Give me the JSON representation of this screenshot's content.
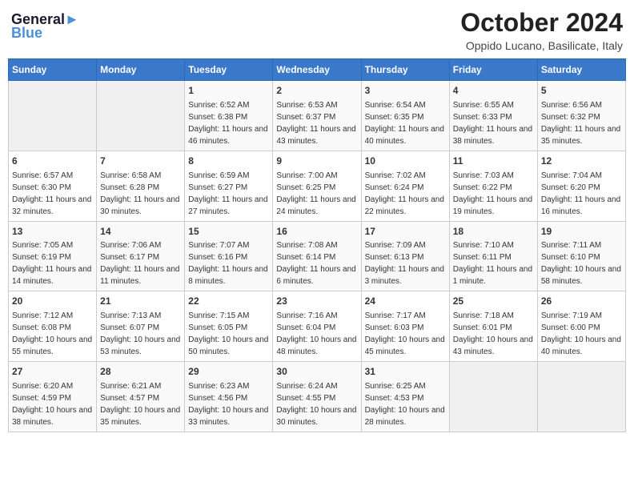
{
  "header": {
    "logo_line1": "General",
    "logo_line2": "Blue",
    "month": "October 2024",
    "location": "Oppido Lucano, Basilicate, Italy"
  },
  "days_of_week": [
    "Sunday",
    "Monday",
    "Tuesday",
    "Wednesday",
    "Thursday",
    "Friday",
    "Saturday"
  ],
  "weeks": [
    [
      {
        "day": "",
        "detail": ""
      },
      {
        "day": "",
        "detail": ""
      },
      {
        "day": "1",
        "detail": "Sunrise: 6:52 AM\nSunset: 6:38 PM\nDaylight: 11 hours and 46 minutes."
      },
      {
        "day": "2",
        "detail": "Sunrise: 6:53 AM\nSunset: 6:37 PM\nDaylight: 11 hours and 43 minutes."
      },
      {
        "day": "3",
        "detail": "Sunrise: 6:54 AM\nSunset: 6:35 PM\nDaylight: 11 hours and 40 minutes."
      },
      {
        "day": "4",
        "detail": "Sunrise: 6:55 AM\nSunset: 6:33 PM\nDaylight: 11 hours and 38 minutes."
      },
      {
        "day": "5",
        "detail": "Sunrise: 6:56 AM\nSunset: 6:32 PM\nDaylight: 11 hours and 35 minutes."
      }
    ],
    [
      {
        "day": "6",
        "detail": "Sunrise: 6:57 AM\nSunset: 6:30 PM\nDaylight: 11 hours and 32 minutes."
      },
      {
        "day": "7",
        "detail": "Sunrise: 6:58 AM\nSunset: 6:28 PM\nDaylight: 11 hours and 30 minutes."
      },
      {
        "day": "8",
        "detail": "Sunrise: 6:59 AM\nSunset: 6:27 PM\nDaylight: 11 hours and 27 minutes."
      },
      {
        "day": "9",
        "detail": "Sunrise: 7:00 AM\nSunset: 6:25 PM\nDaylight: 11 hours and 24 minutes."
      },
      {
        "day": "10",
        "detail": "Sunrise: 7:02 AM\nSunset: 6:24 PM\nDaylight: 11 hours and 22 minutes."
      },
      {
        "day": "11",
        "detail": "Sunrise: 7:03 AM\nSunset: 6:22 PM\nDaylight: 11 hours and 19 minutes."
      },
      {
        "day": "12",
        "detail": "Sunrise: 7:04 AM\nSunset: 6:20 PM\nDaylight: 11 hours and 16 minutes."
      }
    ],
    [
      {
        "day": "13",
        "detail": "Sunrise: 7:05 AM\nSunset: 6:19 PM\nDaylight: 11 hours and 14 minutes."
      },
      {
        "day": "14",
        "detail": "Sunrise: 7:06 AM\nSunset: 6:17 PM\nDaylight: 11 hours and 11 minutes."
      },
      {
        "day": "15",
        "detail": "Sunrise: 7:07 AM\nSunset: 6:16 PM\nDaylight: 11 hours and 8 minutes."
      },
      {
        "day": "16",
        "detail": "Sunrise: 7:08 AM\nSunset: 6:14 PM\nDaylight: 11 hours and 6 minutes."
      },
      {
        "day": "17",
        "detail": "Sunrise: 7:09 AM\nSunset: 6:13 PM\nDaylight: 11 hours and 3 minutes."
      },
      {
        "day": "18",
        "detail": "Sunrise: 7:10 AM\nSunset: 6:11 PM\nDaylight: 11 hours and 1 minute."
      },
      {
        "day": "19",
        "detail": "Sunrise: 7:11 AM\nSunset: 6:10 PM\nDaylight: 10 hours and 58 minutes."
      }
    ],
    [
      {
        "day": "20",
        "detail": "Sunrise: 7:12 AM\nSunset: 6:08 PM\nDaylight: 10 hours and 55 minutes."
      },
      {
        "day": "21",
        "detail": "Sunrise: 7:13 AM\nSunset: 6:07 PM\nDaylight: 10 hours and 53 minutes."
      },
      {
        "day": "22",
        "detail": "Sunrise: 7:15 AM\nSunset: 6:05 PM\nDaylight: 10 hours and 50 minutes."
      },
      {
        "day": "23",
        "detail": "Sunrise: 7:16 AM\nSunset: 6:04 PM\nDaylight: 10 hours and 48 minutes."
      },
      {
        "day": "24",
        "detail": "Sunrise: 7:17 AM\nSunset: 6:03 PM\nDaylight: 10 hours and 45 minutes."
      },
      {
        "day": "25",
        "detail": "Sunrise: 7:18 AM\nSunset: 6:01 PM\nDaylight: 10 hours and 43 minutes."
      },
      {
        "day": "26",
        "detail": "Sunrise: 7:19 AM\nSunset: 6:00 PM\nDaylight: 10 hours and 40 minutes."
      }
    ],
    [
      {
        "day": "27",
        "detail": "Sunrise: 6:20 AM\nSunset: 4:59 PM\nDaylight: 10 hours and 38 minutes."
      },
      {
        "day": "28",
        "detail": "Sunrise: 6:21 AM\nSunset: 4:57 PM\nDaylight: 10 hours and 35 minutes."
      },
      {
        "day": "29",
        "detail": "Sunrise: 6:23 AM\nSunset: 4:56 PM\nDaylight: 10 hours and 33 minutes."
      },
      {
        "day": "30",
        "detail": "Sunrise: 6:24 AM\nSunset: 4:55 PM\nDaylight: 10 hours and 30 minutes."
      },
      {
        "day": "31",
        "detail": "Sunrise: 6:25 AM\nSunset: 4:53 PM\nDaylight: 10 hours and 28 minutes."
      },
      {
        "day": "",
        "detail": ""
      },
      {
        "day": "",
        "detail": ""
      }
    ]
  ]
}
